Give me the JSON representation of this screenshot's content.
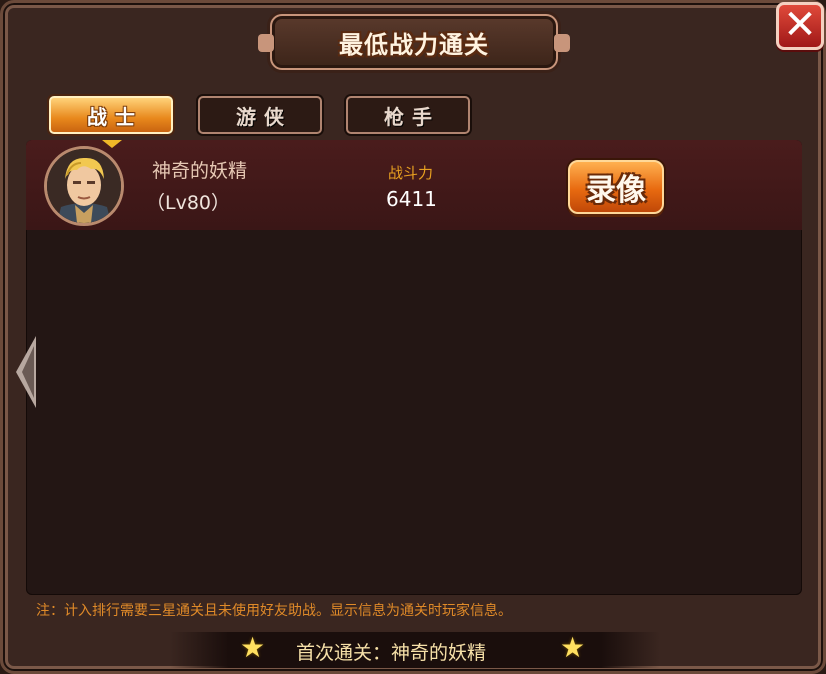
{
  "dialog": {
    "title": "最低战力通关",
    "close_icon": "close-icon"
  },
  "tabs": [
    {
      "label": "战士",
      "active": true
    },
    {
      "label": "游侠",
      "active": false
    },
    {
      "label": "枪手",
      "active": false
    }
  ],
  "records": [
    {
      "player_name": "神奇的妖精",
      "level": "（Lv80）",
      "power_label": "战斗力",
      "power_value": "6411",
      "replay_label": "录像"
    }
  ],
  "note": "注：计入排行需要三星通关且未使用好友助战。显示信息为通关时玩家信息。",
  "first_clear": "首次通关：神奇的妖精",
  "colors": {
    "accent_orange": "#e8881c",
    "power_label": "#e8a020",
    "note_text": "#e08a28",
    "close_red": "#c02820",
    "star_yellow": "#ffe060"
  }
}
